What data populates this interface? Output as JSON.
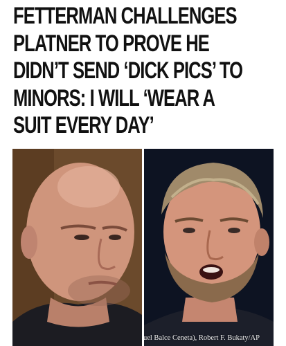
{
  "article": {
    "headline_lines": [
      "FETTERMAN CHALLENGES",
      "PLATNER TO PROVE HE",
      "DIDN’T SEND ‘DICK PICS’ TO",
      "MINORS: I WILL ‘WEAR A",
      "SUIT EVERY DAY’"
    ]
  },
  "photo": {
    "credit": "AP Photo/Manuel Balce Ceneta), Robert F. Bukaty/AP"
  }
}
